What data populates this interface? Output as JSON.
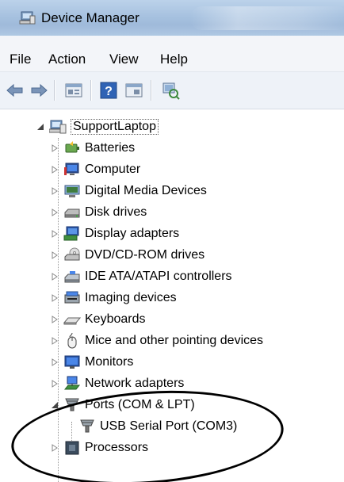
{
  "window": {
    "title": "Device Manager"
  },
  "menu": [
    "File",
    "Action",
    "View",
    "Help"
  ],
  "toolbar": {
    "buttons": [
      {
        "name": "back-arrow-icon"
      },
      {
        "name": "forward-arrow-icon"
      },
      {
        "name": "properties-icon"
      },
      {
        "name": "help-icon"
      },
      {
        "name": "show-hidden-icon"
      },
      {
        "name": "scan-hardware-icon"
      }
    ]
  },
  "tree": {
    "root": "SupportLaptop",
    "items": [
      {
        "label": "Batteries",
        "icon": "battery-icon",
        "expanded": false
      },
      {
        "label": "Computer",
        "icon": "computer-icon",
        "expanded": false
      },
      {
        "label": "Digital Media Devices",
        "icon": "media-device-icon",
        "expanded": false
      },
      {
        "label": "Disk drives",
        "icon": "disk-drive-icon",
        "expanded": false
      },
      {
        "label": "Display adapters",
        "icon": "display-adapter-icon",
        "expanded": false
      },
      {
        "label": "DVD/CD-ROM drives",
        "icon": "dvd-drive-icon",
        "expanded": false
      },
      {
        "label": "IDE ATA/ATAPI controllers",
        "icon": "ide-controller-icon",
        "expanded": false
      },
      {
        "label": "Imaging devices",
        "icon": "imaging-device-icon",
        "expanded": false
      },
      {
        "label": "Keyboards",
        "icon": "keyboard-icon",
        "expanded": false
      },
      {
        "label": "Mice and other pointing devices",
        "icon": "mouse-icon",
        "expanded": false
      },
      {
        "label": "Monitors",
        "icon": "monitor-icon",
        "expanded": false
      },
      {
        "label": "Network adapters",
        "icon": "network-adapter-icon",
        "expanded": false
      },
      {
        "label": "Ports (COM & LPT)",
        "icon": "port-icon",
        "expanded": true,
        "children": [
          {
            "label": "USB Serial Port (COM3)",
            "icon": "port-icon"
          }
        ]
      },
      {
        "label": "Processors",
        "icon": "processor-icon",
        "expanded": false
      }
    ]
  }
}
